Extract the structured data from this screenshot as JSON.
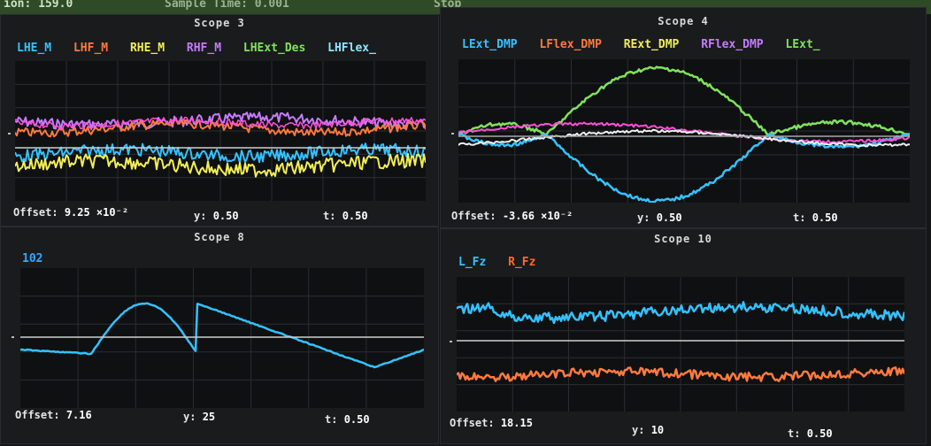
{
  "topbar": {
    "left_text": "ion: 159.0",
    "middle_text": "Sample Time: 0.001",
    "right_text": "Stop"
  },
  "scopes": [
    {
      "title": "Scope 3",
      "legend": [
        {
          "label": "LHE_M",
          "color": "#33c2ff"
        },
        {
          "label": "LHF_M",
          "color": "#ff7a3d"
        },
        {
          "label": "RHE_M",
          "color": "#f2ee55"
        },
        {
          "label": "RHF_M",
          "color": "#c57bff"
        },
        {
          "label": "LHExt_Des",
          "color": "#7fe35a"
        },
        {
          "label": "LHFlex_",
          "color": "#8fe6ff"
        }
      ],
      "offset_label": "Offset:",
      "offset_value": "9.25 ×10⁻²",
      "y_label": "y:",
      "y_value": "0.50",
      "t_label": "t:",
      "t_value": "0.50"
    },
    {
      "title": "Scope 4",
      "legend": [
        {
          "label": "LExt_DMP",
          "color": "#33c2ff"
        },
        {
          "label": "LFlex_DMP",
          "color": "#ff7a3d"
        },
        {
          "label": "RExt_DMP",
          "color": "#f2ee55"
        },
        {
          "label": "RFlex_DMP",
          "color": "#c57bff"
        },
        {
          "label": "LExt_",
          "color": "#7fe35a"
        }
      ],
      "offset_label": "Offset:",
      "offset_value": "-3.66 ×10⁻²",
      "y_label": "y:",
      "y_value": "0.50",
      "t_label": "t:",
      "t_value": "0.50"
    },
    {
      "title": "Scope 8",
      "legend": [
        {
          "label": "102",
          "color": "#33a8ff"
        }
      ],
      "offset_label": "Offset:",
      "offset_value": "7.16",
      "y_label": "y:",
      "y_value": "25",
      "t_label": "t:",
      "t_value": "0.50"
    },
    {
      "title": "Scope 10",
      "legend": [
        {
          "label": "L_Fz",
          "color": "#33c2ff"
        },
        {
          "label": "R_Fz",
          "color": "#ff6a2a"
        }
      ],
      "offset_label": "Offset:",
      "offset_value": "18.15",
      "y_label": "y:",
      "y_value": "10",
      "t_label": "t:",
      "t_value": "0.50"
    }
  ],
  "colors": {
    "blue": "#33c2ff",
    "orange": "#ff7a3d",
    "yellow": "#f2ee55",
    "purple": "#c57bff",
    "pink": "#ff4fd8",
    "green": "#7fe35a",
    "white": "#f0f0f0",
    "grid": "#2b2d31",
    "zero": "#d0d0d0"
  }
}
